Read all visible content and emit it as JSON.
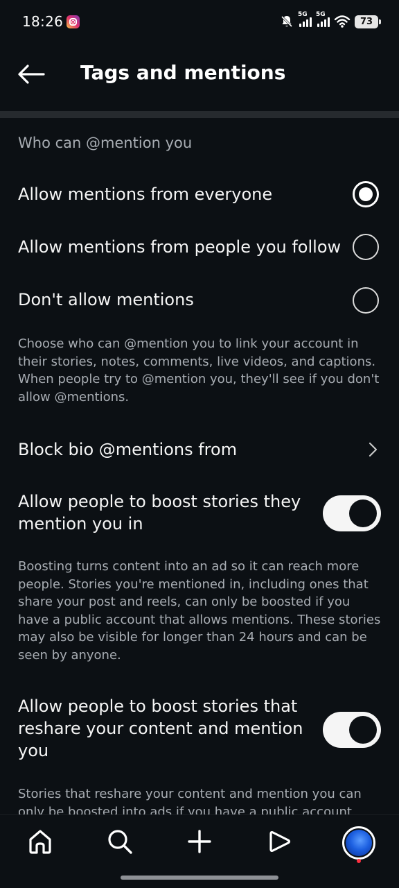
{
  "status_bar": {
    "time": "18:26",
    "network_1": "5G",
    "network_2": "5G",
    "battery": "73",
    "icons": [
      "instagram-notification-icon",
      "mute-bell-icon",
      "signal-icon",
      "signal-icon",
      "wifi-icon",
      "battery-icon"
    ]
  },
  "header": {
    "title": "Tags and mentions",
    "back_icon": "back-arrow-icon"
  },
  "mentions": {
    "heading": "Who can @mention you",
    "options": [
      {
        "label": "Allow mentions from everyone",
        "selected": true
      },
      {
        "label": "Allow mentions from people you follow",
        "selected": false
      },
      {
        "label": "Don't allow mentions",
        "selected": false
      }
    ],
    "description": "Choose who can @mention you to link your account in their stories, notes, comments, live videos, and captions. When people try to @mention you, they'll see if you don't allow @mentions."
  },
  "block_bio": {
    "label": "Block bio @mentions from",
    "icon": "chevron-right-icon"
  },
  "boost_stories": {
    "label": "Allow people to boost stories they mention you in",
    "enabled": true,
    "description": "Boosting turns content into an ad so it can reach more people. Stories you're mentioned in, including ones that share your post and reels, can only be boosted if you have a public account that allows mentions. These stories may also be visible for longer than 24 hours and can be seen by anyone."
  },
  "boost_reshare": {
    "label": "Allow people to boost stories that reshare your content and mention you",
    "enabled": true,
    "description": "Stories that reshare your content and mention you can only be boosted into ads if you have a public account that"
  },
  "bottom_nav": {
    "items": [
      "home-icon",
      "search-icon",
      "create-icon",
      "reels-icon",
      "profile-avatar"
    ]
  },
  "colors": {
    "background": "#0c1014",
    "text_primary": "#f5f5f5",
    "text_secondary": "#a8adb3",
    "divider": "#262a2e",
    "notification_dot": "#ff3040"
  }
}
